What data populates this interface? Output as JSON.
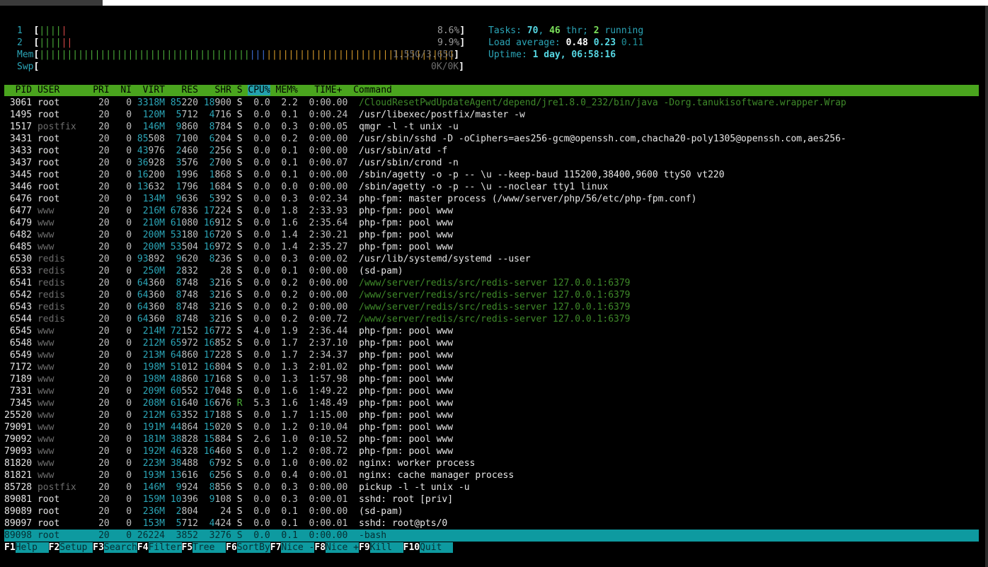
{
  "meters": {
    "cpu1": {
      "label": "1",
      "bars_green": "||||",
      "bars_red": "|",
      "value": "8.6%"
    },
    "cpu2": {
      "label": "2",
      "bars_green": "||||",
      "bars_red": "||",
      "value": "9.9%"
    },
    "mem": {
      "label": "Mem",
      "bars_green": "||||||||||||||||||||||||||||||||||||||",
      "bars_blue": "|||",
      "bars_orange": "||||||||||||||||||||||||||||||||||",
      "value": "1.55G/3.65G"
    },
    "swp": {
      "label": "Swp",
      "value": "0K/0K"
    }
  },
  "stats": {
    "tasks_label": "Tasks:",
    "tasks_count": "70",
    "thr_count": "46",
    "thr_label": "thr;",
    "running_count": "2",
    "running_label": "running",
    "load_label": "Load average:",
    "load1": "0.48",
    "load5": "0.23",
    "load15": "0.11",
    "uptime_label": "Uptime:",
    "uptime_value": "1 day, 06:58:16"
  },
  "columns": {
    "header_pre": "  PID USER      PRI  NI  VIRT   RES   SHR S ",
    "header_sorted": "CPU%",
    "header_post": " MEM%   TIME+  Command"
  },
  "processes": [
    {
      "pid": "3061",
      "user": "root",
      "pri": "20",
      "ni": "0",
      "virt": "3318M",
      "res": "85220",
      "shr": "18900",
      "s": "S",
      "cpu": "0.0",
      "mem": "2.2",
      "time": "0:00.00",
      "cmd": "/CloudResetPwdUpdateAgent/depend/jre1.8.0_232/bin/java -Dorg.tanukisoftware.wrapper.Wrap"
    },
    {
      "pid": "1495",
      "user": "root",
      "pri": "20",
      "ni": "0",
      "virt": "120M",
      "res": "5712",
      "shr": "4716",
      "s": "S",
      "cpu": "0.0",
      "mem": "0.1",
      "time": "0:00.24",
      "cmd": "/usr/libexec/postfix/master -w"
    },
    {
      "pid": "1517",
      "user": "postfix",
      "pri": "20",
      "ni": "0",
      "virt": "146M",
      "res": "9860",
      "shr": "8784",
      "s": "S",
      "cpu": "0.0",
      "mem": "0.3",
      "time": "0:00.05",
      "cmd": "qmgr -l -t unix -u"
    },
    {
      "pid": "3431",
      "user": "root",
      "pri": "20",
      "ni": "0",
      "virt": "85508",
      "res": "7100",
      "shr": "6204",
      "s": "S",
      "cpu": "0.0",
      "mem": "0.2",
      "time": "0:00.00",
      "cmd": "/usr/sbin/sshd -D -oCiphers=aes256-gcm@openssh.com,chacha20-poly1305@openssh.com,aes256-"
    },
    {
      "pid": "3433",
      "user": "root",
      "pri": "20",
      "ni": "0",
      "virt": "43976",
      "res": "2460",
      "shr": "2256",
      "s": "S",
      "cpu": "0.0",
      "mem": "0.1",
      "time": "0:00.00",
      "cmd": "/usr/sbin/atd -f"
    },
    {
      "pid": "3437",
      "user": "root",
      "pri": "20",
      "ni": "0",
      "virt": "36928",
      "res": "3576",
      "shr": "2700",
      "s": "S",
      "cpu": "0.0",
      "mem": "0.1",
      "time": "0:00.07",
      "cmd": "/usr/sbin/crond -n"
    },
    {
      "pid": "3445",
      "user": "root",
      "pri": "20",
      "ni": "0",
      "virt": "16200",
      "res": "1996",
      "shr": "1868",
      "s": "S",
      "cpu": "0.0",
      "mem": "0.1",
      "time": "0:00.00",
      "cmd": "/sbin/agetty -o -p -- \\u --keep-baud 115200,38400,9600 ttyS0 vt220"
    },
    {
      "pid": "3446",
      "user": "root",
      "pri": "20",
      "ni": "0",
      "virt": "13632",
      "res": "1796",
      "shr": "1684",
      "s": "S",
      "cpu": "0.0",
      "mem": "0.0",
      "time": "0:00.00",
      "cmd": "/sbin/agetty -o -p -- \\u --noclear tty1 linux"
    },
    {
      "pid": "6476",
      "user": "root",
      "pri": "20",
      "ni": "0",
      "virt": "134M",
      "res": "9636",
      "shr": "5392",
      "s": "S",
      "cpu": "0.0",
      "mem": "0.3",
      "time": "0:02.34",
      "cmd": "php-fpm: master process (/www/server/php/56/etc/php-fpm.conf)"
    },
    {
      "pid": "6477",
      "user": "www",
      "pri": "20",
      "ni": "0",
      "virt": "216M",
      "res": "67836",
      "shr": "17224",
      "s": "S",
      "cpu": "0.0",
      "mem": "1.8",
      "time": "2:33.93",
      "cmd": "php-fpm: pool www"
    },
    {
      "pid": "6479",
      "user": "www",
      "pri": "20",
      "ni": "0",
      "virt": "210M",
      "res": "61080",
      "shr": "16912",
      "s": "S",
      "cpu": "0.0",
      "mem": "1.6",
      "time": "2:35.64",
      "cmd": "php-fpm: pool www"
    },
    {
      "pid": "6482",
      "user": "www",
      "pri": "20",
      "ni": "0",
      "virt": "200M",
      "res": "53180",
      "shr": "16720",
      "s": "S",
      "cpu": "0.0",
      "mem": "1.4",
      "time": "2:30.21",
      "cmd": "php-fpm: pool www"
    },
    {
      "pid": "6485",
      "user": "www",
      "pri": "20",
      "ni": "0",
      "virt": "200M",
      "res": "53504",
      "shr": "16972",
      "s": "S",
      "cpu": "0.0",
      "mem": "1.4",
      "time": "2:35.27",
      "cmd": "php-fpm: pool www"
    },
    {
      "pid": "6530",
      "user": "redis",
      "pri": "20",
      "ni": "0",
      "virt": "93892",
      "res": "9620",
      "shr": "8236",
      "s": "S",
      "cpu": "0.0",
      "mem": "0.3",
      "time": "0:00.02",
      "cmd": "/usr/lib/systemd/systemd --user"
    },
    {
      "pid": "6533",
      "user": "redis",
      "pri": "20",
      "ni": "0",
      "virt": "250M",
      "res": "2832",
      "shr": "28",
      "s": "S",
      "cpu": "0.0",
      "mem": "0.1",
      "time": "0:00.00",
      "cmd": "(sd-pam)"
    },
    {
      "pid": "6541",
      "user": "redis",
      "pri": "20",
      "ni": "0",
      "virt": "64360",
      "res": "8748",
      "shr": "3216",
      "s": "S",
      "cpu": "0.0",
      "mem": "0.2",
      "time": "0:00.00",
      "cmd": "/www/server/redis/src/redis-server 127.0.0.1:6379",
      "thread": true
    },
    {
      "pid": "6542",
      "user": "redis",
      "pri": "20",
      "ni": "0",
      "virt": "64360",
      "res": "8748",
      "shr": "3216",
      "s": "S",
      "cpu": "0.0",
      "mem": "0.2",
      "time": "0:00.00",
      "cmd": "/www/server/redis/src/redis-server 127.0.0.1:6379",
      "thread": true
    },
    {
      "pid": "6543",
      "user": "redis",
      "pri": "20",
      "ni": "0",
      "virt": "64360",
      "res": "8748",
      "shr": "3216",
      "s": "S",
      "cpu": "0.0",
      "mem": "0.2",
      "time": "0:00.00",
      "cmd": "/www/server/redis/src/redis-server 127.0.0.1:6379",
      "thread": true
    },
    {
      "pid": "6544",
      "user": "redis",
      "pri": "20",
      "ni": "0",
      "virt": "64360",
      "res": "8748",
      "shr": "3216",
      "s": "S",
      "cpu": "0.0",
      "mem": "0.2",
      "time": "0:00.72",
      "cmd": "/www/server/redis/src/redis-server 127.0.0.1:6379",
      "thread": true
    },
    {
      "pid": "6545",
      "user": "www",
      "pri": "20",
      "ni": "0",
      "virt": "214M",
      "res": "72152",
      "shr": "16772",
      "s": "S",
      "cpu": "4.0",
      "mem": "1.9",
      "time": "2:36.44",
      "cmd": "php-fpm: pool www"
    },
    {
      "pid": "6548",
      "user": "www",
      "pri": "20",
      "ni": "0",
      "virt": "212M",
      "res": "65972",
      "shr": "16852",
      "s": "S",
      "cpu": "0.0",
      "mem": "1.7",
      "time": "2:37.10",
      "cmd": "php-fpm: pool www"
    },
    {
      "pid": "6549",
      "user": "www",
      "pri": "20",
      "ni": "0",
      "virt": "213M",
      "res": "64860",
      "shr": "17228",
      "s": "S",
      "cpu": "0.0",
      "mem": "1.7",
      "time": "2:34.37",
      "cmd": "php-fpm: pool www"
    },
    {
      "pid": "7172",
      "user": "www",
      "pri": "20",
      "ni": "0",
      "virt": "198M",
      "res": "51012",
      "shr": "16804",
      "s": "S",
      "cpu": "0.0",
      "mem": "1.3",
      "time": "2:01.02",
      "cmd": "php-fpm: pool www"
    },
    {
      "pid": "7189",
      "user": "www",
      "pri": "20",
      "ni": "0",
      "virt": "198M",
      "res": "48860",
      "shr": "17168",
      "s": "S",
      "cpu": "0.0",
      "mem": "1.3",
      "time": "1:57.98",
      "cmd": "php-fpm: pool www"
    },
    {
      "pid": "7331",
      "user": "www",
      "pri": "20",
      "ni": "0",
      "virt": "209M",
      "res": "60552",
      "shr": "17048",
      "s": "S",
      "cpu": "0.0",
      "mem": "1.6",
      "time": "1:49.22",
      "cmd": "php-fpm: pool www"
    },
    {
      "pid": "7345",
      "user": "www",
      "pri": "20",
      "ni": "0",
      "virt": "208M",
      "res": "61640",
      "shr": "16676",
      "s": "R",
      "cpu": "5.3",
      "mem": "1.6",
      "time": "1:48.49",
      "cmd": "php-fpm: pool www"
    },
    {
      "pid": "25520",
      "user": "www",
      "pri": "20",
      "ni": "0",
      "virt": "212M",
      "res": "63352",
      "shr": "17188",
      "s": "S",
      "cpu": "0.0",
      "mem": "1.7",
      "time": "1:15.00",
      "cmd": "php-fpm: pool www"
    },
    {
      "pid": "79091",
      "user": "www",
      "pri": "20",
      "ni": "0",
      "virt": "191M",
      "res": "44864",
      "shr": "15020",
      "s": "S",
      "cpu": "0.0",
      "mem": "1.2",
      "time": "0:10.04",
      "cmd": "php-fpm: pool www"
    },
    {
      "pid": "79092",
      "user": "www",
      "pri": "20",
      "ni": "0",
      "virt": "181M",
      "res": "38828",
      "shr": "15884",
      "s": "S",
      "cpu": "2.6",
      "mem": "1.0",
      "time": "0:10.52",
      "cmd": "php-fpm: pool www"
    },
    {
      "pid": "79093",
      "user": "www",
      "pri": "20",
      "ni": "0",
      "virt": "192M",
      "res": "46328",
      "shr": "16460",
      "s": "S",
      "cpu": "0.0",
      "mem": "1.2",
      "time": "0:08.72",
      "cmd": "php-fpm: pool www"
    },
    {
      "pid": "81820",
      "user": "www",
      "pri": "20",
      "ni": "0",
      "virt": "223M",
      "res": "38488",
      "shr": "6792",
      "s": "S",
      "cpu": "0.0",
      "mem": "1.0",
      "time": "0:00.02",
      "cmd": "nginx: worker process"
    },
    {
      "pid": "81821",
      "user": "www",
      "pri": "20",
      "ni": "0",
      "virt": "193M",
      "res": "13616",
      "shr": "6256",
      "s": "S",
      "cpu": "0.0",
      "mem": "0.4",
      "time": "0:00.01",
      "cmd": "nginx: cache manager process"
    },
    {
      "pid": "85728",
      "user": "postfix",
      "pri": "20",
      "ni": "0",
      "virt": "146M",
      "res": "9924",
      "shr": "8856",
      "s": "S",
      "cpu": "0.0",
      "mem": "0.3",
      "time": "0:00.00",
      "cmd": "pickup -l -t unix -u"
    },
    {
      "pid": "89081",
      "user": "root",
      "pri": "20",
      "ni": "0",
      "virt": "159M",
      "res": "10396",
      "shr": "9108",
      "s": "S",
      "cpu": "0.0",
      "mem": "0.3",
      "time": "0:00.01",
      "cmd": "sshd: root [priv]"
    },
    {
      "pid": "89089",
      "user": "root",
      "pri": "20",
      "ni": "0",
      "virt": "236M",
      "res": "2804",
      "shr": "24",
      "s": "S",
      "cpu": "0.0",
      "mem": "0.1",
      "time": "0:00.00",
      "cmd": "(sd-pam)"
    },
    {
      "pid": "89097",
      "user": "root",
      "pri": "20",
      "ni": "0",
      "virt": "153M",
      "res": "5712",
      "shr": "4424",
      "s": "S",
      "cpu": "0.0",
      "mem": "0.1",
      "time": "0:00.01",
      "cmd": "sshd: root@pts/0"
    },
    {
      "pid": "89098",
      "user": "root",
      "pri": "20",
      "ni": "0",
      "virt": "26224",
      "res": "3852",
      "shr": "3276",
      "s": "S",
      "cpu": "0.0",
      "mem": "0.1",
      "time": "0:00.00",
      "cmd": "-bash",
      "selected": true
    }
  ],
  "function_keys": [
    {
      "key": "F1",
      "label": "Help  "
    },
    {
      "key": "F2",
      "label": "Setup "
    },
    {
      "key": "F3",
      "label": "Search"
    },
    {
      "key": "F4",
      "label": "Filter"
    },
    {
      "key": "F5",
      "label": "Tree  "
    },
    {
      "key": "F6",
      "label": "SortBy"
    },
    {
      "key": "F7",
      "label": "Nice -"
    },
    {
      "key": "F8",
      "label": "Nice +"
    },
    {
      "key": "F9",
      "label": "Kill  "
    },
    {
      "key": "F10",
      "label": "Quit  "
    }
  ],
  "colors": {
    "header_bg": "#4aa51e",
    "selection_bg": "#0e9aa0",
    "background": "#000000"
  }
}
